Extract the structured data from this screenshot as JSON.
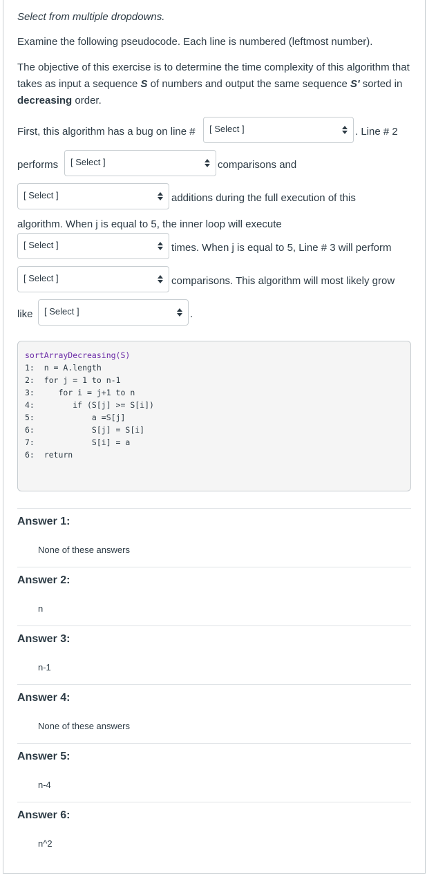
{
  "question": {
    "type_label": "Select from multiple dropdowns.",
    "intro": "Examine the following pseudocode. Each line is numbered (leftmost number).",
    "objective_prefix": "The objective of this exercise is to determine the time complexity of this algorithm that takes as input a sequence ",
    "objective_S": "S",
    "objective_mid": " of numbers and output the same sequence ",
    "objective_S2": "S'",
    "objective_mid2": " sorted in ",
    "objective_bold": "decreasing",
    "objective_end": " order.",
    "line1_prefix": "First, this algorithm has a bug on line #",
    "line1_suffix": ". Line # 2",
    "line2_prefix": "performs",
    "line2_suffix": "comparisons and",
    "line3_suffix": "additions during the full execution of this",
    "line4": "algorithm. When j is equal to 5, the inner loop will execute",
    "line5_suffix": "times. When j is equal to 5, Line # 3 will perform",
    "line6_suffix": "comparisons. This algorithm will most likely grow",
    "line7_prefix": "like",
    "line7_suffix": "."
  },
  "dropdowns": [
    {
      "selected": "[ Select ]"
    },
    {
      "selected": "[ Select ]"
    },
    {
      "selected": "[ Select ]"
    },
    {
      "selected": "[ Select ]"
    },
    {
      "selected": "[ Select ]"
    },
    {
      "selected": "[ Select ]"
    }
  ],
  "code": {
    "header": "sortArrayDecreasing(S)",
    "lines": [
      "1:  n = A.length",
      "2:  for j = 1 to n-1",
      "3:     for i = j+1 to n",
      "4:        if (S[j] >= S[i])",
      "5:            a =S[j]",
      "6:            S[j] = S[i]",
      "7:            S[i] = a",
      "6:  return"
    ]
  },
  "answers": [
    {
      "title": "Answer 1:",
      "value": "None of these answers"
    },
    {
      "title": "Answer 2:",
      "value": "n"
    },
    {
      "title": "Answer 3:",
      "value": "n-1"
    },
    {
      "title": "Answer 4:",
      "value": "None of these answers"
    },
    {
      "title": "Answer 5:",
      "value": "n-4"
    },
    {
      "title": "Answer 6:",
      "value": "n^2"
    }
  ]
}
